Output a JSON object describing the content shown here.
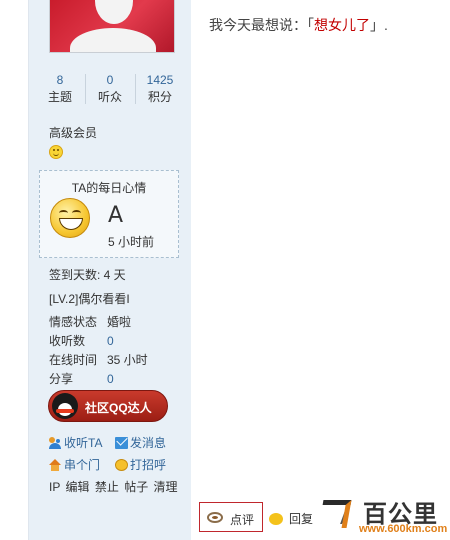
{
  "sidebar": {
    "stats": [
      {
        "value": "8",
        "label": "主题"
      },
      {
        "value": "0",
        "label": "听众"
      },
      {
        "value": "1425",
        "label": "积分"
      }
    ],
    "rank": "高级会员",
    "mood": {
      "title": "TA的每日心情",
      "letter": "A",
      "time": "5 小时前"
    },
    "signin": "签到天数: 4 天",
    "level": "[LV.2]偶尔看看I",
    "fields": [
      {
        "key": "情感状态",
        "value": "婚啦"
      },
      {
        "key": "收听数",
        "value": "0"
      },
      {
        "key": "在线时间",
        "value": "35 小时"
      },
      {
        "key": "分享",
        "value": "0"
      }
    ],
    "qq_badge": "社区QQ达人",
    "actions": {
      "follow": "收听TA",
      "message": "发消息",
      "visit": "串个门",
      "greet": "打招呼"
    },
    "admin": [
      "IP",
      "编辑",
      "禁止",
      "帖子",
      "清理"
    ]
  },
  "post": {
    "prefix": "我今天最想说：「",
    "highlight": "想女儿了",
    "suffix": "」."
  },
  "bottom": {
    "comment": "点评",
    "reply": "回复"
  },
  "watermark": {
    "title": "百公里",
    "url": "www.600km.com"
  }
}
